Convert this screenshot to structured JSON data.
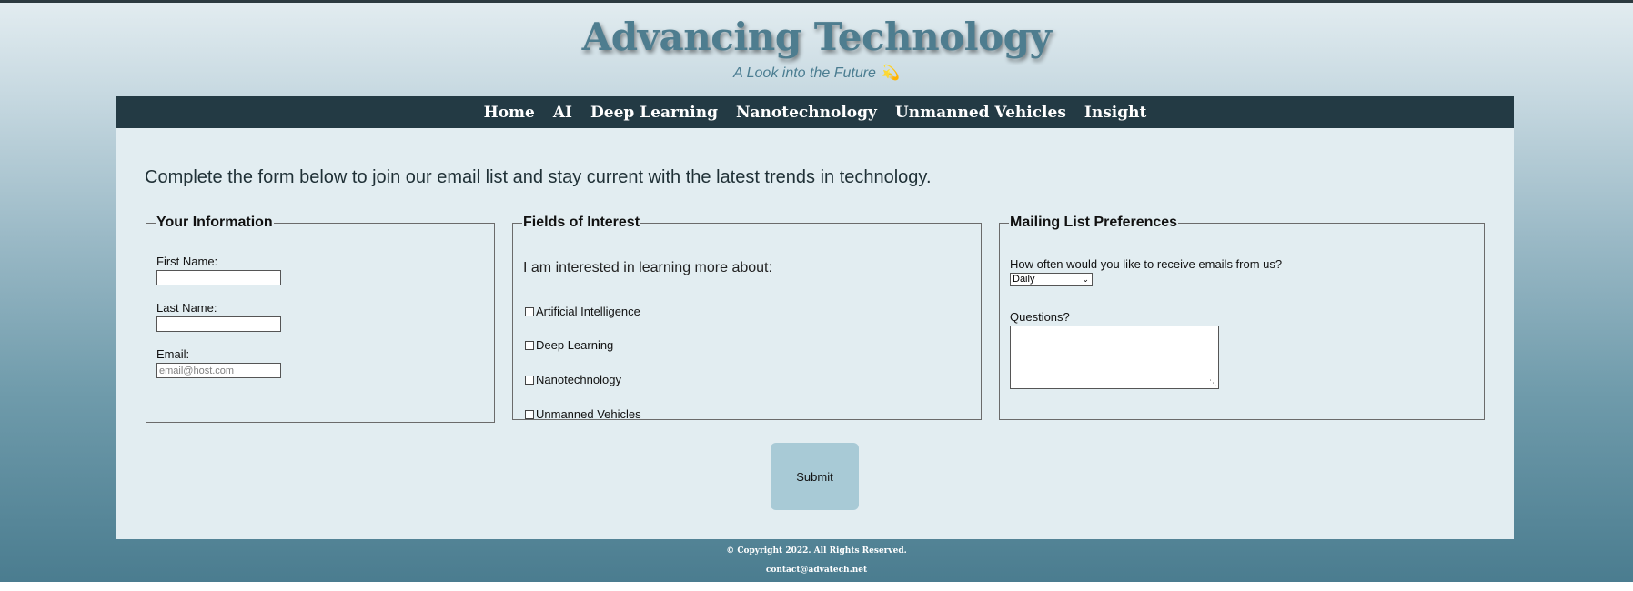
{
  "header": {
    "title": "Advancing Technology",
    "tagline": "A Look into the Future",
    "tagline_icon": "sparkle-icon"
  },
  "nav": [
    "Home",
    "AI",
    "Deep Learning",
    "Nanotechnology",
    "Unmanned Vehicles",
    "Insight"
  ],
  "intro": "Complete the form below to join our email list and stay current with the latest trends in technology.",
  "your_info": {
    "legend": "Your Information",
    "first_name_label": "First Name:",
    "first_name_value": "",
    "last_name_label": "Last Name:",
    "last_name_value": "",
    "email_label": "Email:",
    "email_placeholder": "email@host.com"
  },
  "interests": {
    "legend": "Fields of Interest",
    "prompt": "I am interested in learning more about:",
    "options": [
      "Artificial Intelligence",
      "Deep Learning",
      "Nanotechnology",
      "Unmanned Vehicles"
    ]
  },
  "mailing": {
    "legend": "Mailing List Preferences",
    "frequency_question": "How often would you like to receive emails from us?",
    "frequency_value": "Daily",
    "questions_label": "Questions?",
    "questions_value": ""
  },
  "submit_label": "Submit",
  "footer": {
    "copyright": "© Copyright 2022. All Rights Reserved.",
    "contact": "contact@advatech.net"
  },
  "colors": {
    "nav_bg": "#233a44",
    "content_bg": "#e2edf1",
    "title": "#4e7d8f",
    "submit_bg": "#a8cad6"
  }
}
